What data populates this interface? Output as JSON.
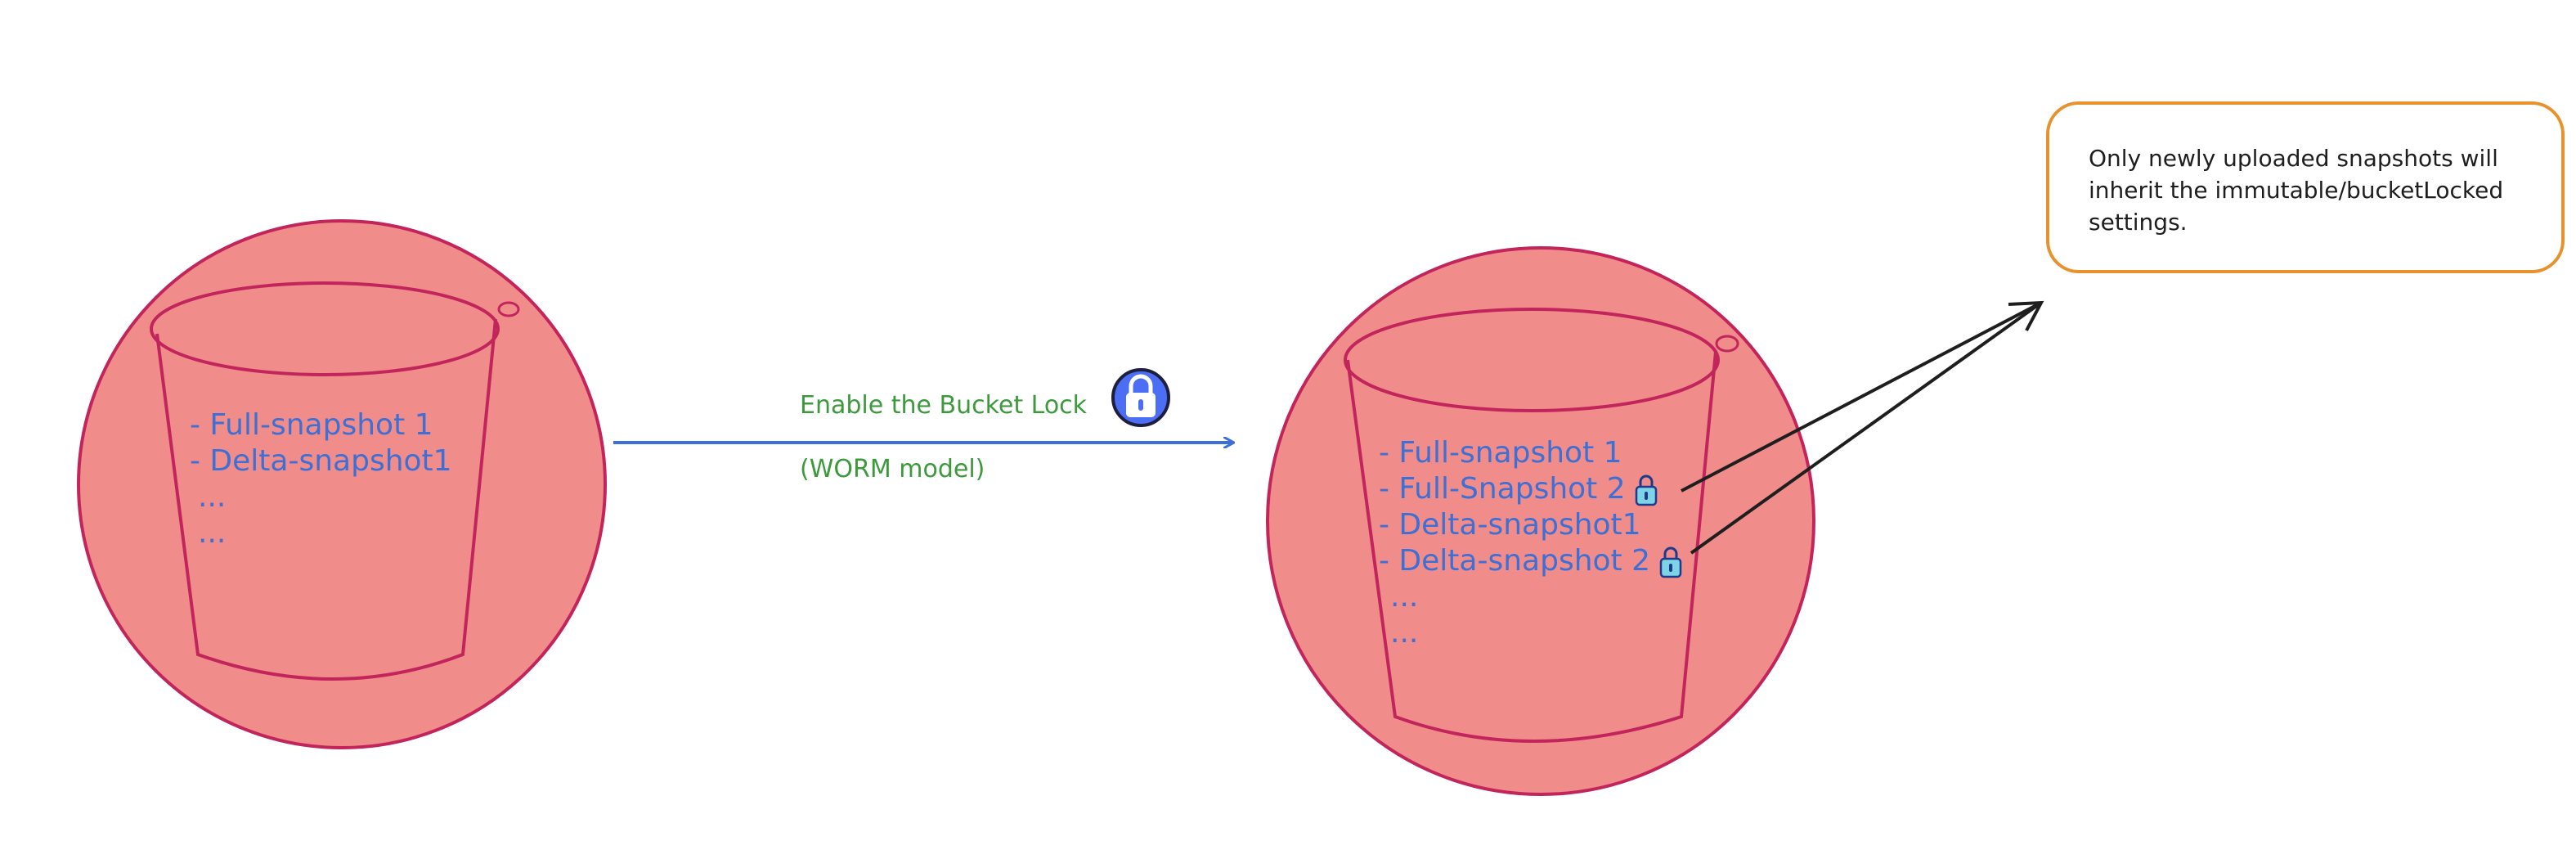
{
  "colors": {
    "bucket_fill": "#f08c8a",
    "bucket_stroke": "#c2255c",
    "item_text": "#3d6fd4",
    "arrow": "#3d6fd4",
    "label_green": "#3c9a3c",
    "note_border": "#e8922e",
    "lock_badge": "#4c6ef5"
  },
  "source_bucket": {
    "items": [
      "- Full-snapshot 1",
      "- Delta-snapshot1",
      "...",
      "..."
    ]
  },
  "transition": {
    "label": "Enable the Bucket Lock",
    "sublabel": "(WORM model)",
    "icon": "lock-icon"
  },
  "target_bucket": {
    "items": [
      {
        "text": "- Full-snapshot 1",
        "locked": false
      },
      {
        "text": "- Full-Snapshot 2",
        "locked": true
      },
      {
        "text": "- Delta-snapshot1",
        "locked": false
      },
      {
        "text": "- Delta-snapshot 2",
        "locked": true
      },
      {
        "text": "...",
        "locked": false
      },
      {
        "text": "...",
        "locked": false
      }
    ]
  },
  "note": {
    "lines": [
      "Only newly uploaded snapshots will",
      "inherit the immutable/bucketLocked",
      "settings."
    ]
  }
}
